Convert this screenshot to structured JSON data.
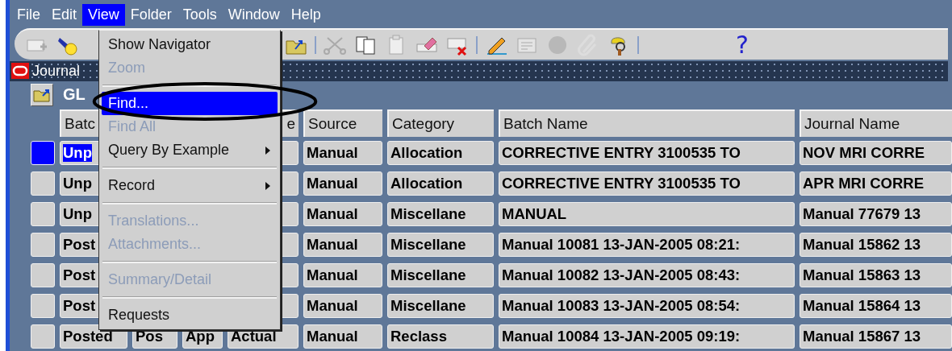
{
  "menubar": {
    "items": [
      {
        "label": "File",
        "selected": false
      },
      {
        "label": "Edit",
        "selected": false
      },
      {
        "label": "View",
        "selected": true
      },
      {
        "label": "Folder",
        "selected": false
      },
      {
        "label": "Tools",
        "selected": false
      },
      {
        "label": "Window",
        "selected": false
      },
      {
        "label": "Help",
        "selected": false
      }
    ]
  },
  "toolbar": {
    "help_glyph": "?"
  },
  "window": {
    "title": "Journal"
  },
  "folder": {
    "label": "GL"
  },
  "annotation": {
    "kind": "ellipse"
  },
  "menu": {
    "items": [
      {
        "kind": "item",
        "label": "Show Navigator",
        "disabled": false,
        "selected": false
      },
      {
        "kind": "item",
        "label": "Zoom",
        "disabled": true,
        "selected": false
      },
      {
        "kind": "separator"
      },
      {
        "kind": "item",
        "label": "Find...",
        "disabled": false,
        "selected": true
      },
      {
        "kind": "item",
        "label": "Find All",
        "disabled": true,
        "selected": false
      },
      {
        "kind": "item",
        "label": "Query By Example",
        "disabled": false,
        "selected": false,
        "submenu": true
      },
      {
        "kind": "separator"
      },
      {
        "kind": "item",
        "label": "Record",
        "disabled": false,
        "selected": false,
        "submenu": true
      },
      {
        "kind": "separator"
      },
      {
        "kind": "item",
        "label": "Translations...",
        "disabled": true,
        "selected": false
      },
      {
        "kind": "item",
        "label": "Attachments...",
        "disabled": true,
        "selected": false
      },
      {
        "kind": "separator"
      },
      {
        "kind": "item",
        "label": "Summary/Detail",
        "disabled": true,
        "selected": false
      },
      {
        "kind": "separator"
      },
      {
        "kind": "item",
        "label": "Requests",
        "disabled": false,
        "selected": false
      }
    ]
  },
  "table": {
    "columns": [
      "Batc",
      null,
      null,
      "e",
      "Source",
      "Category",
      "Batch Name",
      "Journal Name"
    ],
    "rows": [
      {
        "selected": true,
        "cells": [
          "Unp",
          null,
          null,
          null,
          "Manual",
          "Allocation",
          "CORRECTIVE ENTRY 3100535 TO",
          "NOV MRI CORRE"
        ]
      },
      {
        "selected": false,
        "cells": [
          "Unp",
          null,
          null,
          null,
          "Manual",
          "Allocation",
          "CORRECTIVE ENTRY 3100535 TO",
          "APR MRI CORRE"
        ]
      },
      {
        "selected": false,
        "cells": [
          "Unp",
          null,
          null,
          null,
          "Manual",
          "Miscellane",
          "MANUAL",
          "Manual 77679 13"
        ]
      },
      {
        "selected": false,
        "cells": [
          "Post",
          null,
          null,
          null,
          "Manual",
          "Miscellane",
          "Manual 10081 13-JAN-2005 08:21:",
          "Manual 15862 13"
        ]
      },
      {
        "selected": false,
        "cells": [
          "Post",
          null,
          null,
          null,
          "Manual",
          "Miscellane",
          "Manual 10082 13-JAN-2005 08:43:",
          "Manual 15863 13"
        ]
      },
      {
        "selected": false,
        "cells": [
          "Post",
          null,
          null,
          null,
          "Manual",
          "Miscellane",
          "Manual 10083 13-JAN-2005 08:54:",
          "Manual 15864 13"
        ]
      },
      {
        "selected": false,
        "cells": [
          "Posted",
          "Pos",
          "App",
          "Actual",
          "Manual",
          "Reclass",
          "Manual 10084 13-JAN-2005 09:19:",
          "Manual 15867 13"
        ]
      }
    ]
  }
}
